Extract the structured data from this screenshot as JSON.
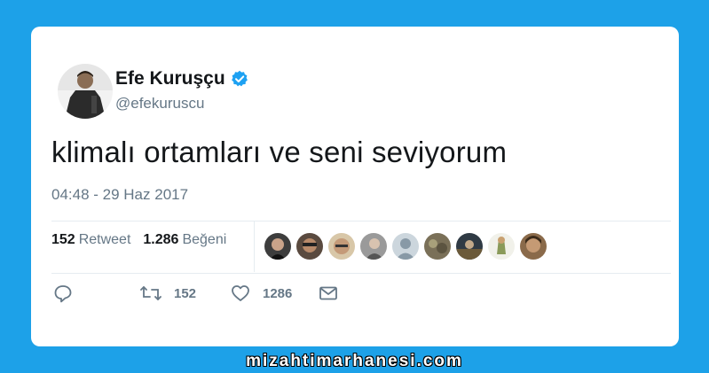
{
  "author": {
    "name": "Efe Kuruşçu",
    "handle": "@efekuruscu",
    "verified_color": "#1da1f2"
  },
  "tweet": {
    "text": "klimalı ortamları ve seni seviyorum",
    "timestamp": "04:48 - 29 Haz 2017"
  },
  "stats": {
    "retweet_count": "152",
    "retweet_label": "Retweet",
    "like_count": "1.286",
    "like_label": "Beğeni",
    "liker_avatars": [
      "liker-avatar-1",
      "liker-avatar-2",
      "liker-avatar-3",
      "liker-avatar-4",
      "liker-avatar-default",
      "liker-avatar-6",
      "liker-avatar-7",
      "liker-avatar-8",
      "liker-avatar-9"
    ]
  },
  "actions": {
    "reply_icon": "reply-icon",
    "retweet_icon": "retweet-icon",
    "retweet_count": "152",
    "like_icon": "heart-icon",
    "like_count": "1286",
    "dm_icon": "envelope-icon"
  },
  "watermark": {
    "text": "mizahtimarhanesi.com"
  },
  "colors": {
    "background": "#1da1e8",
    "card": "#ffffff",
    "primary_text": "#14171a",
    "secondary_text": "#657786",
    "divider": "#e6ecf0"
  }
}
